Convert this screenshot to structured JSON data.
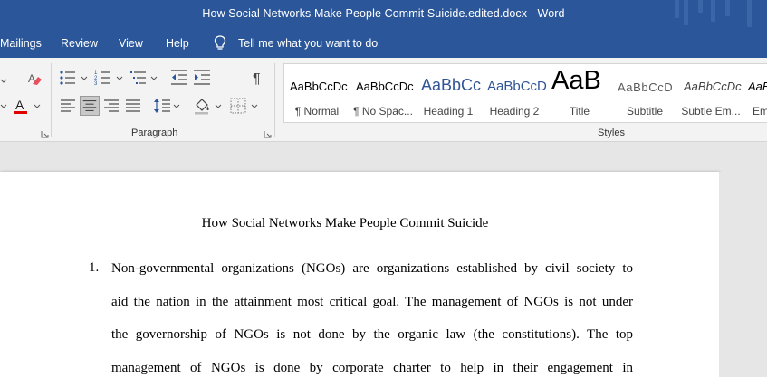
{
  "window": {
    "title": "How Social Networks Make People Commit Suicide.edited.docx  -  Word"
  },
  "menu": {
    "items": [
      "Mailings",
      "Review",
      "View",
      "Help"
    ],
    "tell_me": "Tell me what you want to do"
  },
  "ribbon": {
    "paragraph_label": "Paragraph",
    "styles_label": "Styles",
    "styles": [
      {
        "sample": "AaBbCcDc",
        "name": "¶ Normal"
      },
      {
        "sample": "AaBbCcDc",
        "name": "¶ No Spac..."
      },
      {
        "sample": "AaBbCc",
        "name": "Heading 1"
      },
      {
        "sample": "AaBbCcD",
        "name": "Heading 2"
      },
      {
        "sample": "AaB",
        "name": "Title"
      },
      {
        "sample": "AaBbCcD",
        "name": "Subtitle"
      },
      {
        "sample": "AaBbCcDc",
        "name": "Subtle Em..."
      },
      {
        "sample": "AaBbCc",
        "name": "Em"
      }
    ]
  },
  "document": {
    "title": "How Social Networks Make People Commit Suicide",
    "list_number": "1.",
    "lines": [
      "Non-governmental organizations (NGOs) are organizations established by civil society to",
      "aid the nation in the attainment most critical goal. The management of NGOs is not under",
      "the governorship of NGOs is not done by the organic law (the constitutions).   The top",
      "management of NGOs is done by corporate charter to help in their engagement in"
    ]
  },
  "colors": {
    "word_blue": "#2b579a",
    "ribbon_bg": "#f3f3f3",
    "canvas": "#e6e6e6",
    "heading_blue": "#2f5496"
  }
}
